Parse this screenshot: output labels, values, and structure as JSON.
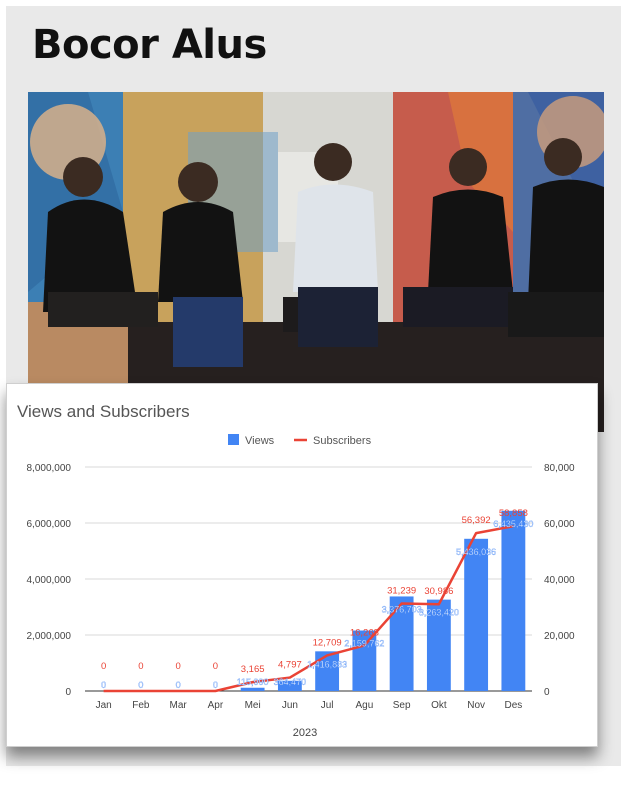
{
  "headline": "Bocor Alus",
  "photo": {
    "icon": "panel-discussion-photo"
  },
  "chart_data": {
    "type": "bar",
    "title": "Views and Subscribers",
    "xlabel": "2023",
    "ylabel": "",
    "y2label": "",
    "categories": [
      "Jan",
      "Feb",
      "Mar",
      "Apr",
      "Mei",
      "Jun",
      "Jul",
      "Agu",
      "Sep",
      "Okt",
      "Nov",
      "Des"
    ],
    "series": [
      {
        "name": "Views",
        "kind": "bar",
        "axis": "left",
        "color": "#4285f4",
        "values": [
          0,
          0,
          0,
          0,
          115990,
          364470,
          1416883,
          2159762,
          3376703,
          3263420,
          5436036,
          6435430
        ],
        "labels": [
          "0",
          "0",
          "0",
          "0",
          "115,990",
          "364,470",
          "1,416,883",
          "2,159,762",
          "3,376,703",
          "3,263,420",
          "5,436,036",
          "6,435,430"
        ]
      },
      {
        "name": "Subscribers",
        "kind": "line",
        "axis": "right",
        "color": "#ea4335",
        "values": [
          0,
          0,
          0,
          0,
          3165,
          4797,
          12709,
          16268,
          31239,
          30986,
          56392,
          58858
        ],
        "labels": [
          "0",
          "0",
          "0",
          "0",
          "3,165",
          "4,797",
          "12,709",
          "16,268",
          "31,239",
          "30,986",
          "56,392",
          "58,858"
        ]
      }
    ],
    "ylim": [
      0,
      8000000
    ],
    "y2lim": [
      0,
      80000
    ],
    "yticks": [
      "0",
      "2,000,000",
      "4,000,000",
      "6,000,000",
      "8,000,000"
    ],
    "y2ticks": [
      "0",
      "20,000",
      "40,000",
      "60,000",
      "80,000"
    ],
    "yticks_values": [
      0,
      2000000,
      4000000,
      6000000,
      8000000
    ],
    "legend": "top-center",
    "grid": true
  }
}
